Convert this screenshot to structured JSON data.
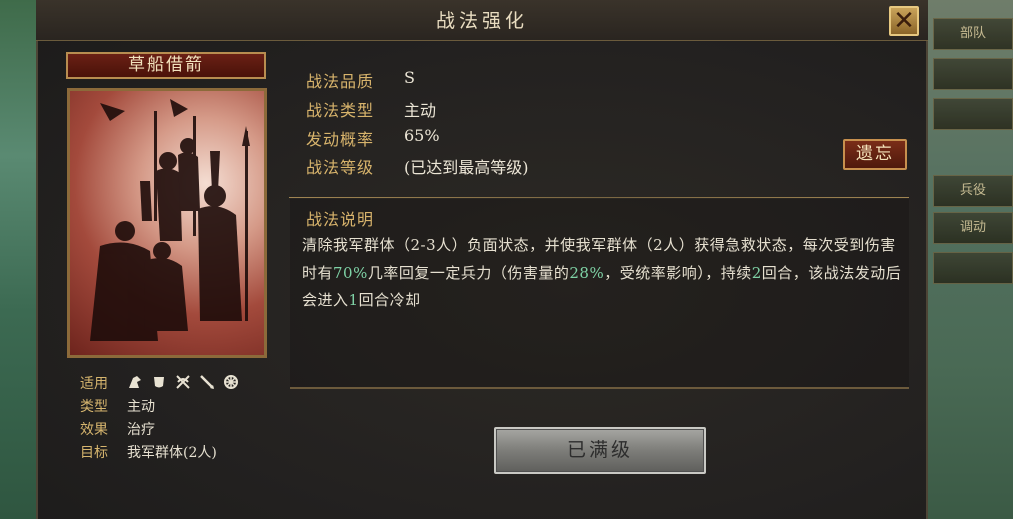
{
  "window": {
    "title": "战法强化",
    "close_icon": "close-icon"
  },
  "side_tabs": [
    "部队",
    "",
    "",
    "兵役",
    "调动",
    ""
  ],
  "card": {
    "name": "草船借箭",
    "info": {
      "suitable_label": "适用",
      "type_label": "类型",
      "type_value": "主动",
      "effect_label": "效果",
      "effect_value": "治疗",
      "target_label": "目标",
      "target_value": "我军群体(2人)"
    },
    "unit_icons": [
      "cavalry-icon",
      "shield-icon",
      "archer-icon",
      "spear-icon",
      "siege-icon"
    ]
  },
  "stats": [
    {
      "label": "战法品质",
      "value": "S"
    },
    {
      "label": "战法类型",
      "value": "主动"
    },
    {
      "label": "发动概率",
      "value": "65%"
    },
    {
      "label": "战法等级",
      "value": "(已达到最高等级)"
    }
  ],
  "forget_button": "遗忘",
  "description": {
    "title": "战法说明",
    "seg1": "清除我军群体（2-3人）负面状态，并使我军群体（2人）获得急救状态，每次受到伤害时有",
    "hl1": "70%",
    "seg2": "几率回复一定兵力（伤害量的",
    "hl2": "28%",
    "seg3": "，受统率影响），持续",
    "hl3": "2",
    "seg4": "回合，该战法发动后会进入",
    "hl4": "1",
    "seg5": "回合冷却"
  },
  "max_level_button": "已满级",
  "colors": {
    "accent_gold": "#d8b46c",
    "highlight_green": "#7fd2a6",
    "button_red": "#7a2d18"
  }
}
